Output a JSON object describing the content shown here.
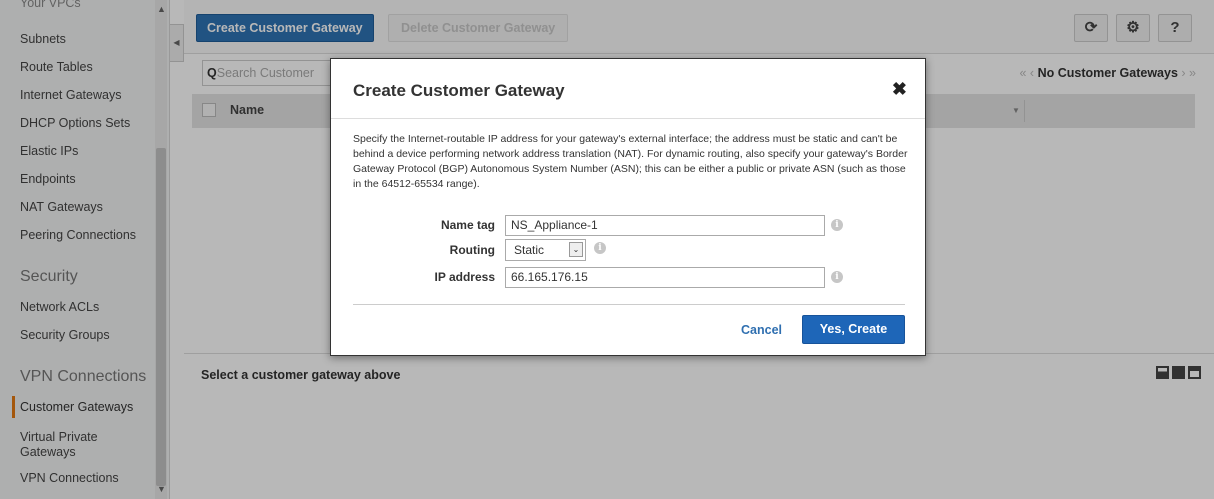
{
  "sidebar": {
    "top_cut_item": "Your VPCs",
    "items": [
      {
        "label": "Subnets"
      },
      {
        "label": "Route Tables"
      },
      {
        "label": "Internet Gateways"
      },
      {
        "label": "DHCP Options Sets"
      },
      {
        "label": "Elastic IPs"
      },
      {
        "label": "Endpoints"
      },
      {
        "label": "NAT Gateways"
      },
      {
        "label": "Peering Connections"
      }
    ],
    "security_heading": "Security",
    "security_items": [
      {
        "label": "Network ACLs"
      },
      {
        "label": "Security Groups"
      }
    ],
    "vpn_heading": "VPN Connections",
    "vpn_items": [
      {
        "label": "Customer Gateways",
        "active": true
      },
      {
        "label": "Virtual Private Gateways"
      },
      {
        "label": "VPN Connections"
      }
    ]
  },
  "toolbar": {
    "create_label": "Create Customer Gateway",
    "delete_label": "Delete Customer Gateway",
    "icons": [
      "refresh-icon",
      "gear-icon",
      "help-icon"
    ]
  },
  "filter": {
    "search_placeholder": "Search Customer",
    "pager_text": "No Customer Gateways"
  },
  "table": {
    "columns": [
      "Name"
    ]
  },
  "detail": {
    "title": "Select a customer gateway above"
  },
  "modal": {
    "title": "Create Customer Gateway",
    "description": "Specify the Internet-routable IP address for your gateway's external interface; the address must be static and can't be behind a device performing network address translation (NAT). For dynamic routing, also specify your gateway's Border Gateway Protocol (BGP) Autonomous System Number (ASN); this can be either a public or private ASN (such as those in the 64512-65534 range).",
    "fields": {
      "name_tag_label": "Name tag",
      "name_tag_value": "NS_Appliance-1",
      "routing_label": "Routing",
      "routing_value": "Static",
      "ip_label": "IP address",
      "ip_value": "66.165.176.15"
    },
    "cancel_label": "Cancel",
    "create_label": "Yes, Create"
  },
  "colors": {
    "primary": "#2f73b5",
    "accent_active": "#e47911",
    "link": "#2f6fb0"
  }
}
